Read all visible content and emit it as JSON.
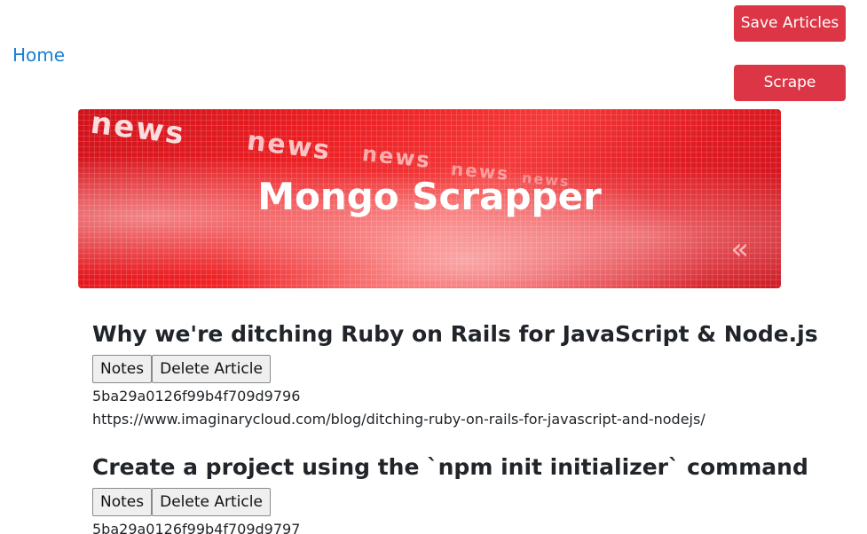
{
  "nav": {
    "home_label": "Home",
    "save_articles_label": "Save Articles",
    "scrape_label": "Scrape"
  },
  "banner": {
    "title": "Mongo Scrapper",
    "background_word": "news",
    "chevron": "«"
  },
  "articles": [
    {
      "title": "Why we're ditching Ruby on Rails for JavaScript & Node.js",
      "notes_label": "Notes",
      "delete_label": "Delete Article",
      "id": "5ba29a0126f99b4f709d9796",
      "link": "https://www.imaginarycloud.com/blog/ditching-ruby-on-rails-for-javascript-and-nodejs/"
    },
    {
      "title": "Create a project using the `npm init initializer` command",
      "notes_label": "Notes",
      "delete_label": "Delete Article",
      "id": "5ba29a0126f99b4f709d9797"
    }
  ],
  "colors": {
    "accent_red": "#dc3545",
    "link_blue": "#1a7fd6"
  }
}
